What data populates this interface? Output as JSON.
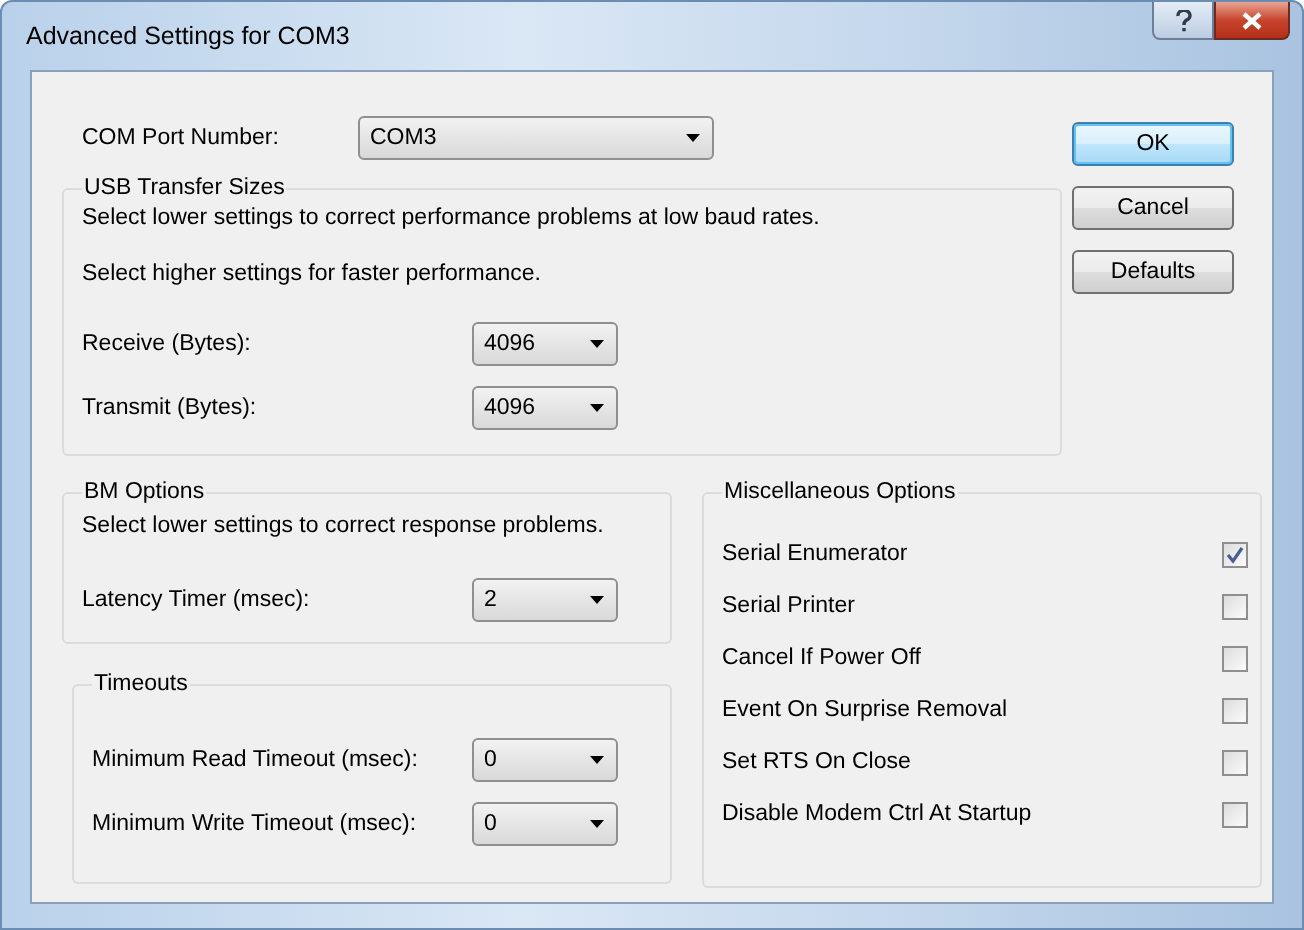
{
  "window": {
    "title": "Advanced Settings for COM3"
  },
  "com_port": {
    "label": "COM Port Number:",
    "value": "COM3"
  },
  "buttons": [
    {
      "label": "OK",
      "default": true
    },
    {
      "label": "Cancel",
      "default": false
    },
    {
      "label": "Defaults",
      "default": false
    }
  ],
  "usb_transfer_sizes": {
    "title": "USB Transfer Sizes",
    "notes": [
      "Select lower settings to correct performance problems at low baud rates.",
      "Select higher settings for faster performance."
    ],
    "fields": [
      {
        "label": "Receive (Bytes):",
        "value": "4096"
      },
      {
        "label": "Transmit (Bytes):",
        "value": "4096"
      }
    ]
  },
  "bm_options": {
    "title": "BM Options",
    "note": "Select lower settings to correct response problems.",
    "fields": [
      {
        "label": "Latency Timer (msec):",
        "value": "2"
      }
    ]
  },
  "timeouts": {
    "title": "Timeouts",
    "fields": [
      {
        "label": "Minimum Read Timeout (msec):",
        "value": "0"
      },
      {
        "label": "Minimum Write Timeout (msec):",
        "value": "0"
      }
    ]
  },
  "miscellaneous_options": {
    "title": "Miscellaneous Options",
    "options": [
      {
        "label": "Serial Enumerator",
        "checked": true
      },
      {
        "label": "Serial Printer",
        "checked": false
      },
      {
        "label": "Cancel If Power Off",
        "checked": false
      },
      {
        "label": "Event On Surprise Removal",
        "checked": false
      },
      {
        "label": "Set RTS On Close",
        "checked": false
      },
      {
        "label": "Disable Modem Ctrl At Startup",
        "checked": false
      }
    ]
  }
}
